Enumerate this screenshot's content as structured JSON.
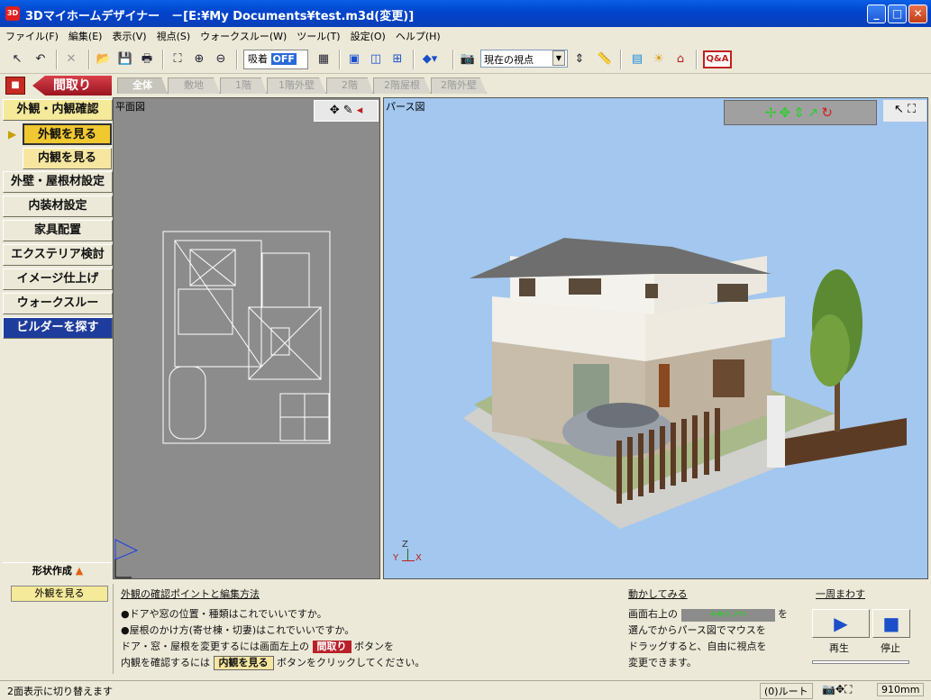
{
  "window": {
    "title": "3Dマイホームデザイナー　－[E:¥My Documents¥test.m3d(変更)]",
    "app_icon": "3D"
  },
  "menu": [
    "ファイル(F)",
    "編集(E)",
    "表示(V)",
    "視点(S)",
    "ウォークスルー(W)",
    "ツール(T)",
    "設定(O)",
    "ヘルプ(H)"
  ],
  "toolbar": {
    "snap_label": "吸着",
    "snap_state": "OFF",
    "viewpoint_value": "現在の視点",
    "qa_label": "Q&A"
  },
  "floorplan_button": "間取り",
  "tabs": [
    "全体",
    "敷地",
    "1階",
    "1階外壁",
    "2階",
    "2階屋根",
    "2階外壁"
  ],
  "sidebar": {
    "items": [
      "外観・内観確認",
      "外観を見る",
      "内観を見る",
      "外壁・屋根材設定",
      "内装材設定",
      "家具配置",
      "エクステリア検討",
      "イメージ仕上げ",
      "ウォークスルー",
      "ビルダーを探す"
    ],
    "footer": "形状作成"
  },
  "plan_view": {
    "label": "平面図"
  },
  "persp_view": {
    "label": "パース図",
    "axis_z": "Z",
    "axis_y": "Y",
    "axis_x": "X"
  },
  "bottom": {
    "mode": "外観を見る",
    "section1_title": "外観の確認ポイントと編集方法",
    "line1": "●ドアや窓の位置・種類はこれでいいですか。",
    "line2": "●屋根のかけ方(寄せ棟・切妻)はこれでいいですか。",
    "line3a": "ドア・窓・屋根を変更するには画面左上の",
    "line3btn": "間取り",
    "line3b": "ボタンを",
    "line4a": "内観を確認するには",
    "line4btn": "内観を見る",
    "line4b": "ボタンをクリックしてください。",
    "section2_title": "動かしてみる",
    "m1a": "画面右上の",
    "m1b": "を",
    "m2": "選んでからパース図でマウスを",
    "m3": "ドラッグすると、自由に視点を",
    "m4": "変更できます。",
    "section3_title": "一周まわす",
    "play": "再生",
    "stop": "停止"
  },
  "status": {
    "left": "2面表示に切り替えます",
    "route": "(0)ルート",
    "grid": "910mm"
  }
}
